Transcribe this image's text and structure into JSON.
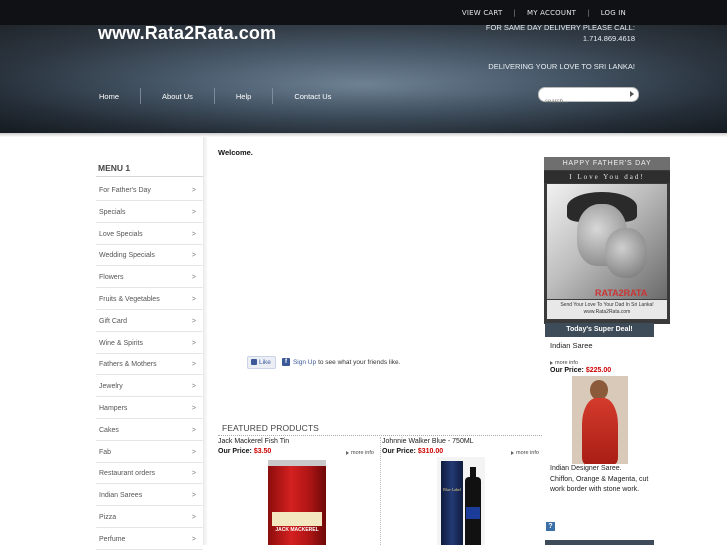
{
  "topbar": {
    "links": [
      "VIEW CART",
      "MY ACCOUNT",
      "LOG IN"
    ],
    "separator": "|"
  },
  "header": {
    "site_title": "www.Rata2Rata.com",
    "delivery_line1": "FOR SAME DAY DELIVERY PLEASE CALL:",
    "delivery_phone": "1.714.869.4618",
    "tagline": "DELIVERING YOUR LOVE TO SRI LANKA!",
    "nav": [
      "Home",
      "About Us",
      "Help",
      "Contact Us"
    ],
    "search_placeholder": "search..."
  },
  "sidebar": {
    "title": "MENU 1",
    "arrow": ">",
    "items": [
      "For Father's Day",
      "Specials",
      "Love Specials",
      "Wedding Specials",
      "Flowers",
      "Fruits & Vegetables",
      "Gift Card",
      "Wine & Spirits",
      "Fathers & Mothers",
      "Jewelry",
      "Hampers",
      "Cakes",
      "Fab",
      "Restaurant orders",
      "Indian Sarees",
      "Pizza",
      "Perfume"
    ]
  },
  "main": {
    "welcome": "Welcome.",
    "facebook": {
      "like": "Like",
      "signup": "Sign Up",
      "rest": "to see what your friends like."
    },
    "featured_title": "FEATURED PRODUCTS",
    "products": [
      {
        "name": "Jack Mackerel Fish Tin",
        "price_label": "Our Price:",
        "price": "$3.50",
        "more": "more info",
        "img_label": "JACK MACKEREL"
      },
      {
        "name": "Johnnie Walker Blue - 750ML",
        "price_label": "Our Price:",
        "price": "$310.00",
        "more": "more info",
        "img_label": "Blue Label"
      }
    ]
  },
  "right": {
    "banner": {
      "line1": "HAPPY FATHER'S DAY",
      "line2": "I Love You dad!",
      "brand": "RATA2RATA",
      "caption1": "Send Your Love To Your Dad In Sri Lanka!",
      "caption2": "www.Rata2Rata.com"
    },
    "deal": {
      "title": "Today's Super Deal!",
      "name": "Indian Saree",
      "more": "more info",
      "price_label": "Our Price:",
      "price": "$225.00",
      "desc_line1": "Indian Designer Saree.",
      "desc_line2": "Chiffon, Orange & Magenta, cut work border with stone work."
    },
    "help_icon": "?"
  },
  "colors": {
    "price_red": "#cc0000",
    "nav_bar": "#3e4b58",
    "facebook_blue": "#3b5998"
  }
}
